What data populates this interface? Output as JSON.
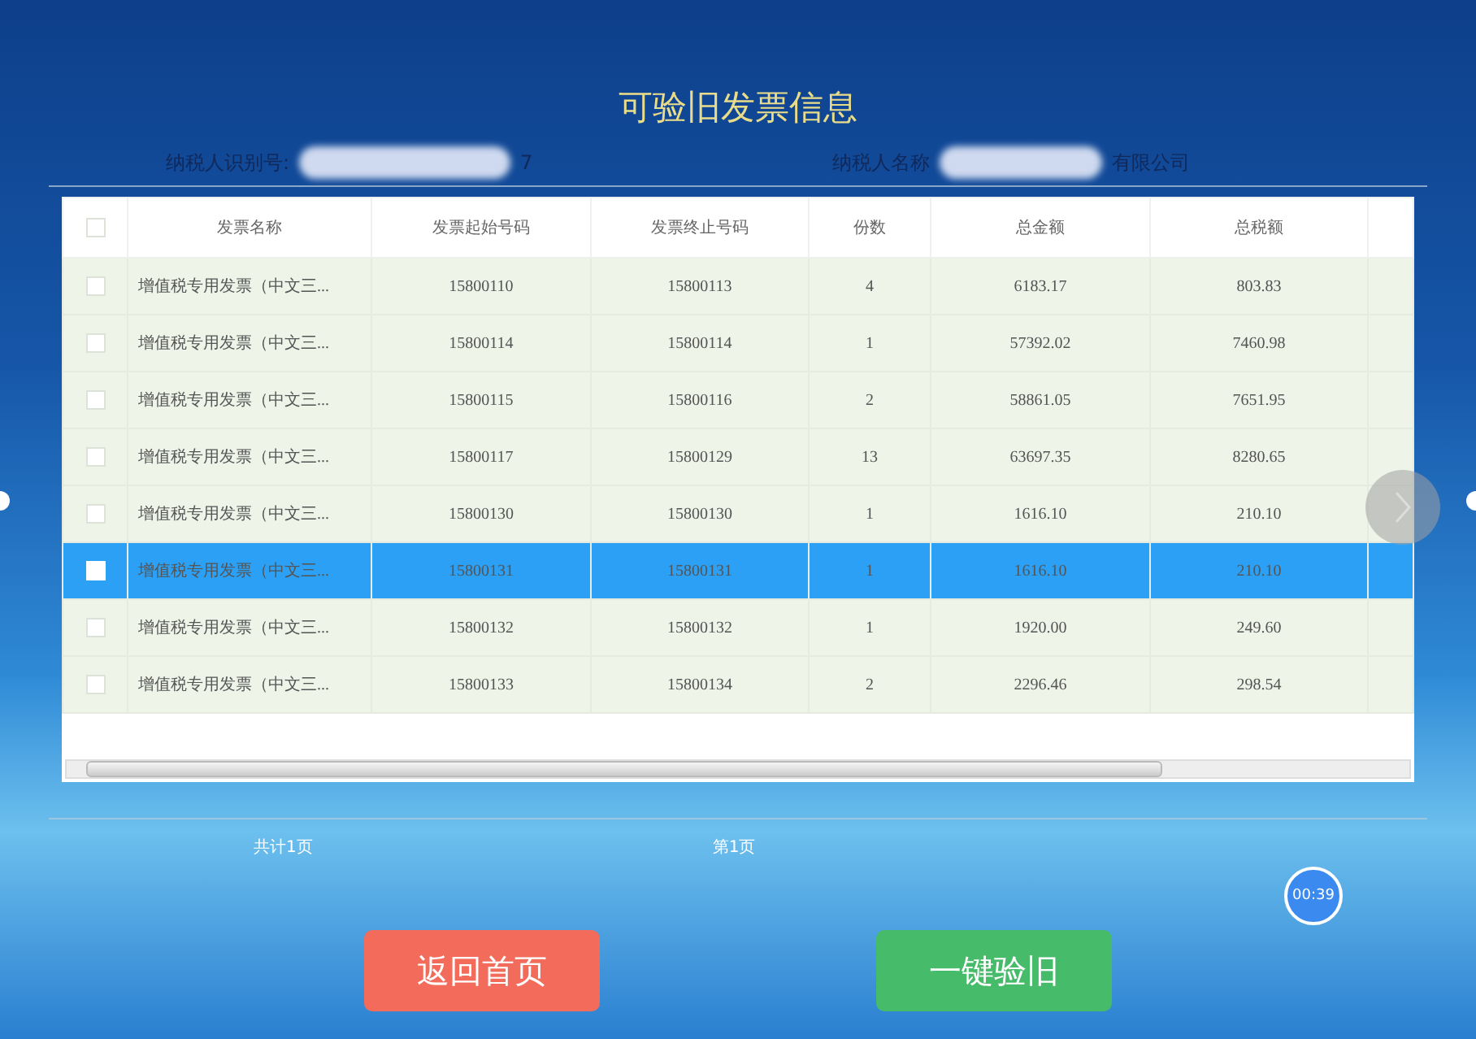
{
  "title": "可验旧发票信息",
  "taxpayer": {
    "id_label": "纳税人识别号:",
    "id_tail": "7",
    "name_label": "纳税人名称",
    "name_tail": "有限公司"
  },
  "table": {
    "all_checked": false,
    "columns": [
      "发票名称",
      "发票起始号码",
      "发票终止号码",
      "份数",
      "总金额",
      "总税额"
    ],
    "rows": [
      {
        "selected": false,
        "checked": false,
        "cells": [
          "增值税专用发票（中文三...",
          "15800110",
          "15800113",
          "4",
          "6183.17",
          "803.83"
        ]
      },
      {
        "selected": false,
        "checked": false,
        "cells": [
          "增值税专用发票（中文三...",
          "15800114",
          "15800114",
          "1",
          "57392.02",
          "7460.98"
        ]
      },
      {
        "selected": false,
        "checked": false,
        "cells": [
          "增值税专用发票（中文三...",
          "15800115",
          "15800116",
          "2",
          "58861.05",
          "7651.95"
        ]
      },
      {
        "selected": false,
        "checked": false,
        "cells": [
          "增值税专用发票（中文三...",
          "15800117",
          "15800129",
          "13",
          "63697.35",
          "8280.65"
        ]
      },
      {
        "selected": false,
        "checked": false,
        "cells": [
          "增值税专用发票（中文三...",
          "15800130",
          "15800130",
          "1",
          "1616.10",
          "210.10"
        ]
      },
      {
        "selected": true,
        "checked": false,
        "cells": [
          "增值税专用发票（中文三...",
          "15800131",
          "15800131",
          "1",
          "1616.10",
          "210.10"
        ]
      },
      {
        "selected": false,
        "checked": false,
        "cells": [
          "增值税专用发票（中文三...",
          "15800132",
          "15800132",
          "1",
          "1920.00",
          "249.60"
        ]
      },
      {
        "selected": false,
        "checked": false,
        "cells": [
          "增值税专用发票（中文三...",
          "15800133",
          "15800134",
          "2",
          "2296.46",
          "298.54"
        ]
      }
    ]
  },
  "pagination": {
    "total": "共计1页",
    "current": "第1页"
  },
  "timer": "00:39",
  "buttons": [
    {
      "kind": "back",
      "label": "返回首页"
    },
    {
      "kind": "confirm",
      "label": "一键验旧"
    }
  ]
}
